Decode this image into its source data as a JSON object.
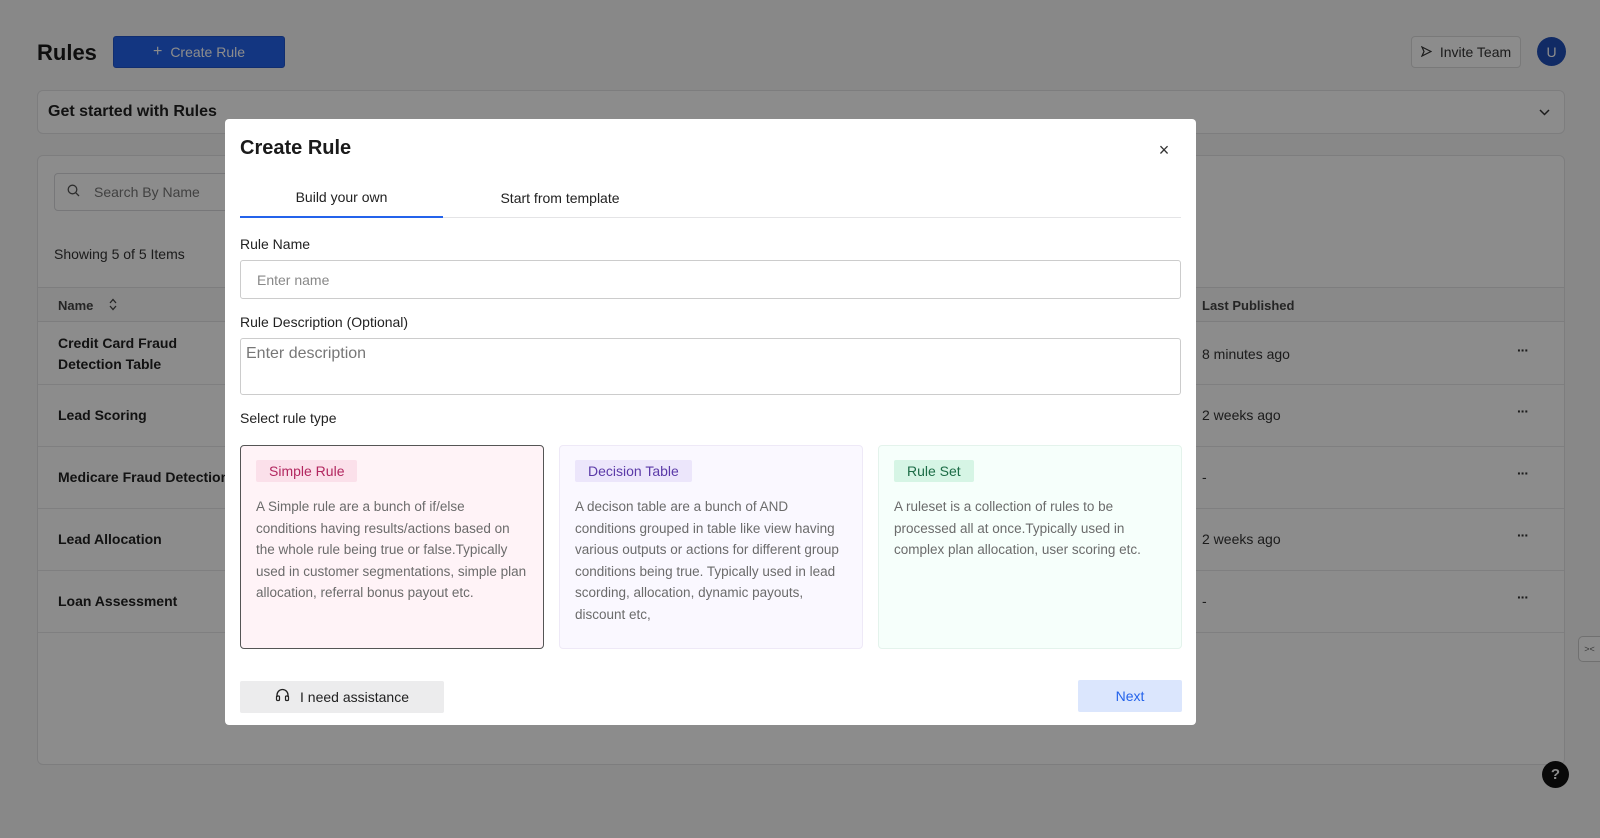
{
  "header": {
    "title": "Rules",
    "create_label": "Create Rule",
    "invite_label": "Invite Team",
    "avatar_initial": "U"
  },
  "getstarted": {
    "title": "Get started with Rules"
  },
  "list": {
    "search_placeholder": "Search By Name",
    "showing": "Showing 5 of 5 Items",
    "columns": {
      "name": "Name",
      "last_published": "Last Published"
    },
    "rows": [
      {
        "name": "Credit Card Fraud Detection Table",
        "last_published": "8 minutes ago",
        "more": "···"
      },
      {
        "name": "Lead Scoring",
        "last_published": "2 weeks ago",
        "more": "···"
      },
      {
        "name": "Medicare Fraud Detection",
        "last_published": "-",
        "more": "···"
      },
      {
        "name": "Lead Allocation",
        "last_published": "2 weeks ago",
        "more": "···"
      },
      {
        "name": "Loan Assessment",
        "last_published": "-",
        "more": "···"
      }
    ]
  },
  "help_label": "?",
  "modal": {
    "title": "Create Rule",
    "close": "×",
    "tabs": [
      "Build your own",
      "Start from template"
    ],
    "rule_name_label": "Rule Name",
    "rule_name_placeholder": "Enter name",
    "rule_desc_label": "Rule Description (Optional)",
    "rule_desc_placeholder": "Enter description",
    "rule_type_label": "Select rule type",
    "rule_types": [
      {
        "badge": "Simple Rule",
        "desc": "A Simple rule are a bunch of if/else conditions having results/actions based on the whole rule being true or false.Typically used in customer segmentations, simple plan allocation, referral bonus payout etc.",
        "selected": true
      },
      {
        "badge": "Decision Table",
        "desc": "A decison table are a bunch of AND conditions grouped in table like view having various outputs or actions for different group conditions being true. Typically used in lead scording, allocation, dynamic payouts, discount etc,",
        "selected": false
      },
      {
        "badge": "Rule Set",
        "desc": "A ruleset is a collection of rules to be processed all at once.Typically used in complex plan allocation, user scoring etc.",
        "selected": false
      }
    ],
    "assist_label": "I need assistance",
    "next_label": "Next"
  },
  "colors": {
    "primary": "#2463eb",
    "simple_rule_accent": "#b2265f",
    "decision_table_accent": "#5b3aa8",
    "rule_set_accent": "#1c6c46"
  }
}
